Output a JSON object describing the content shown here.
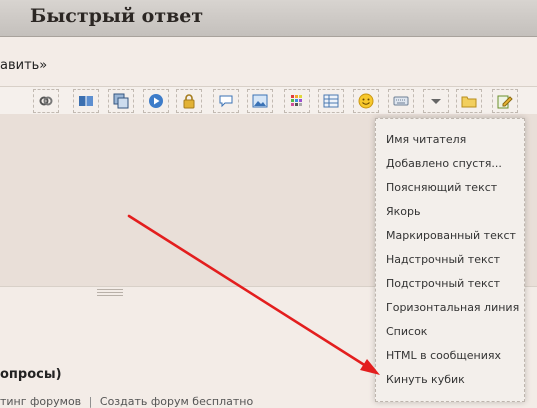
{
  "header": {
    "title": "Быстрый ответ"
  },
  "post_link": "авить»",
  "toolbar": {
    "buttons": [
      {
        "name": "link-icon"
      },
      {
        "name": "book-icon"
      },
      {
        "name": "copy-icon"
      },
      {
        "name": "play-icon"
      },
      {
        "name": "lock-icon"
      },
      {
        "name": "speech-bubble-icon"
      },
      {
        "name": "image-icon"
      },
      {
        "name": "color-palette-icon"
      },
      {
        "name": "table-icon"
      },
      {
        "name": "smiley-icon"
      },
      {
        "name": "keyboard-icon"
      },
      {
        "name": "dropdown-arrow-icon"
      },
      {
        "name": "folder-icon"
      },
      {
        "name": "edit-icon"
      }
    ]
  },
  "dropdown": {
    "items": [
      "Имя читателя",
      "Добавлено спустя...",
      "Поясняющий текст",
      "Якорь",
      "Маркированный текст",
      "Надстрочный текст",
      "Подстрочный текст",
      "Горизонтальная линия",
      "Список",
      "HTML в сообщениях",
      "Кинуть кубик"
    ]
  },
  "questions_label": "опросы)",
  "footer": {
    "rating": "тинг форумов",
    "separator": "|",
    "create_forum": "Создать форум бесплатно"
  },
  "colors": {
    "arrow": "#e31e1e",
    "editor_bg": "#e9dfd8",
    "page_bg": "#f3ece7"
  }
}
